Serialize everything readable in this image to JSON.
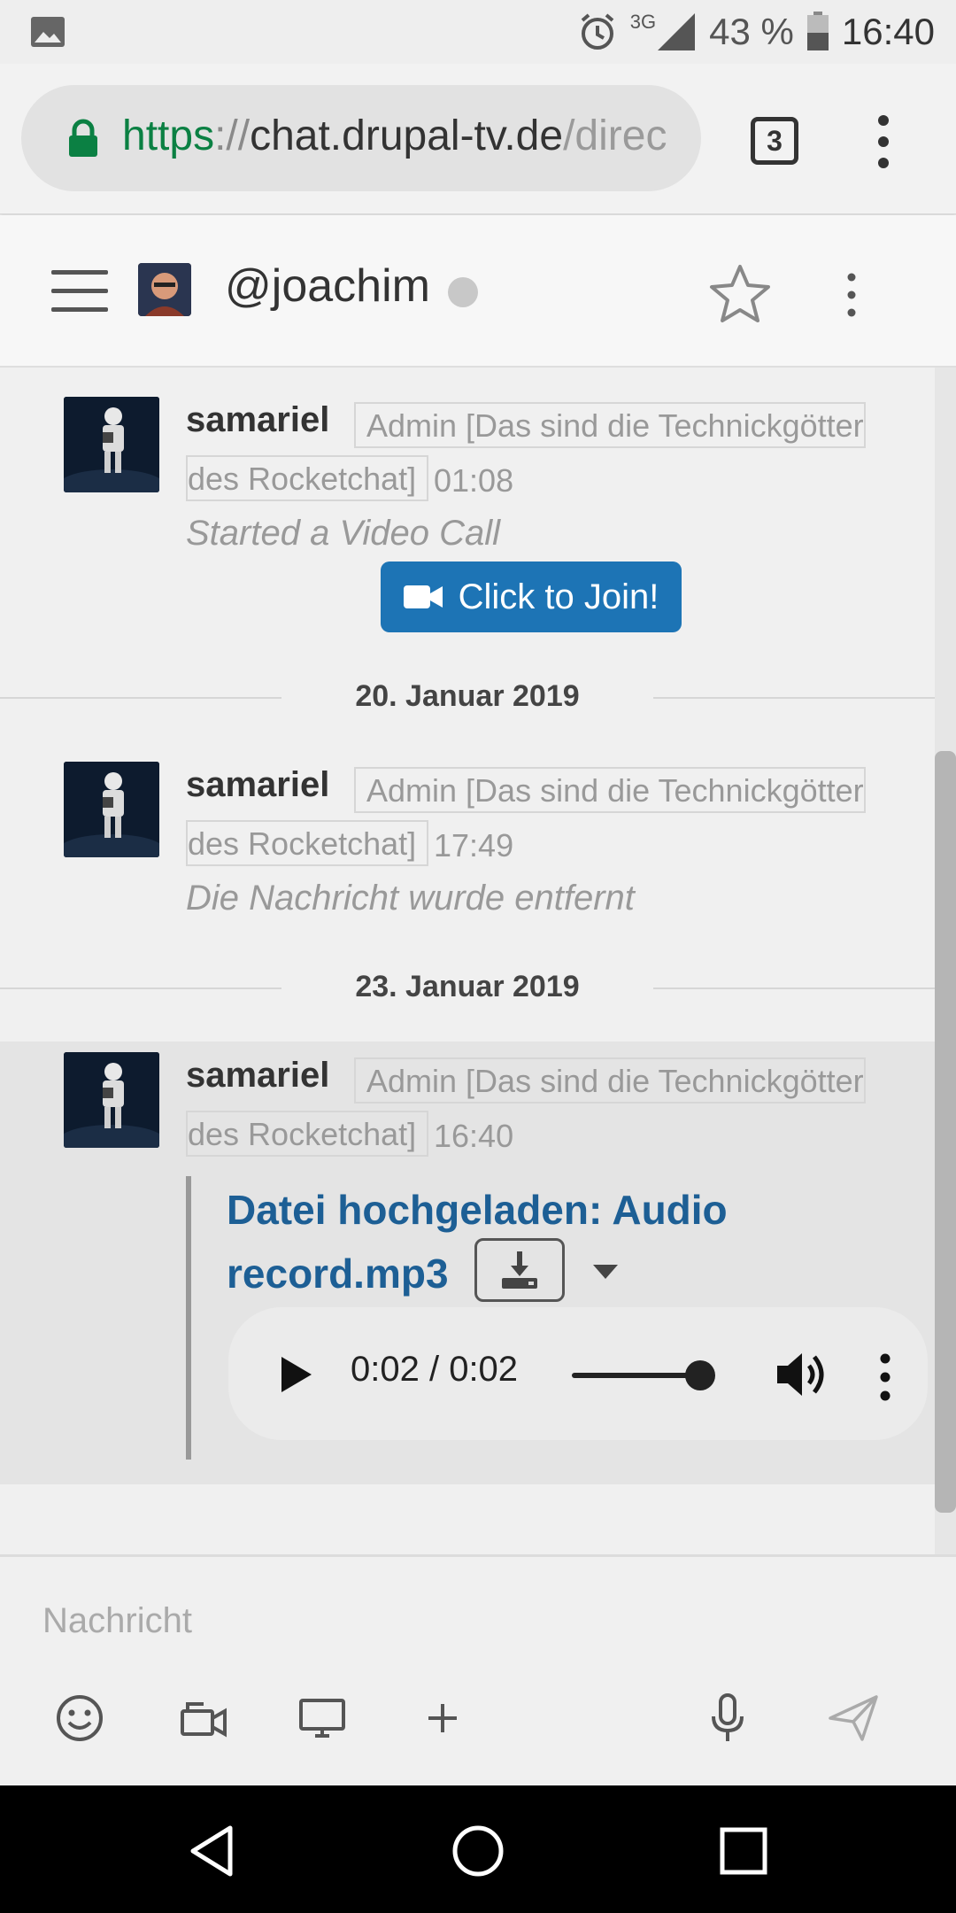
{
  "status_bar": {
    "signal_label": "3G",
    "battery": "43 %",
    "time": "16:40"
  },
  "browser": {
    "url_scheme": "https",
    "url_sep": "://",
    "url_host": "chat.drupal-tv.de",
    "url_path": "/direc",
    "tab_count": "3"
  },
  "room": {
    "name": "@joachim",
    "status_color": "#c8c8c8",
    "starred": false
  },
  "messages": [
    {
      "user": "samariel",
      "role_line1": "Admin [Das sind die Technickgötter",
      "role_line2": "des Rocketchat]",
      "time": "01:08",
      "body": "Started a Video Call",
      "action_label": "Click to Join!"
    },
    {
      "date": "20. Januar 2019",
      "user": "samariel",
      "role_line1": "Admin [Das sind die Technickgötter",
      "role_line2": "des Rocketchat]",
      "time": "17:49",
      "body": "Die Nachricht wurde entfernt"
    },
    {
      "date": "23. Januar 2019",
      "user": "samariel",
      "role_line1": "Admin [Das sind die Technickgötter",
      "role_line2": "des Rocketchat]",
      "time": "16:40",
      "attachment_title": "Datei hochgeladen: Audio record.mp3",
      "player_time": "0:02 / 0:02",
      "player_progress": 1.0
    }
  ],
  "composer": {
    "placeholder": "Nachricht",
    "icons": [
      "emoji-icon",
      "video-message-icon",
      "screen-share-icon",
      "plus-icon",
      "microphone-icon",
      "send-icon"
    ]
  },
  "colors": {
    "accent": "#1d74b5",
    "link": "#1d5f95",
    "secure_url": "#0b8043"
  }
}
